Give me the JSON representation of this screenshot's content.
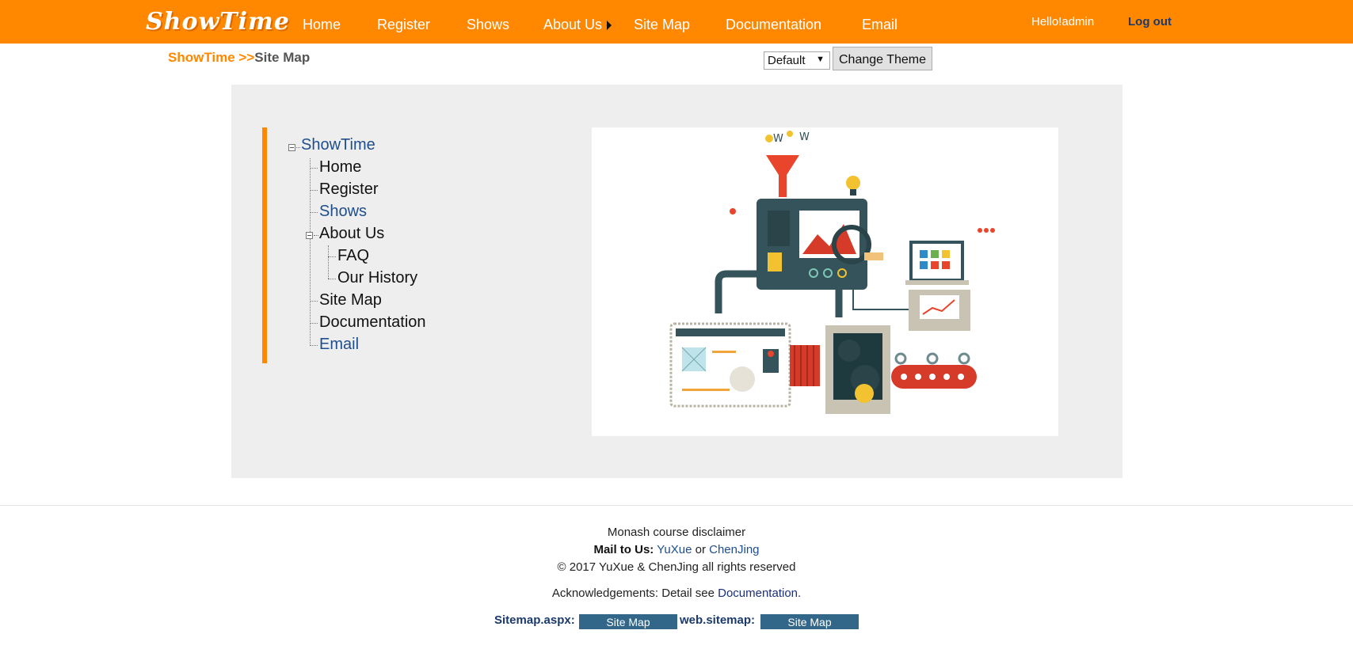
{
  "header": {
    "logo": "ShowTime",
    "nav": [
      {
        "label": "Home"
      },
      {
        "label": "Register"
      },
      {
        "label": "Shows"
      },
      {
        "label": "About Us"
      },
      {
        "label": "Site Map"
      },
      {
        "label": "Documentation"
      },
      {
        "label": "Email"
      }
    ],
    "greeting": "Hello!admin",
    "logout": "Log out"
  },
  "breadcrumb": {
    "root": "ShowTime",
    "separator": " >>",
    "current": "Site Map"
  },
  "theme": {
    "selected": "Default",
    "button": "Change Theme"
  },
  "tree": {
    "root": "ShowTime",
    "items": [
      "Home",
      "Register",
      "Shows",
      "About Us",
      "FAQ",
      "Our History",
      "Site Map",
      "Documentation",
      "Email"
    ]
  },
  "footer": {
    "disclaimer": "Monash course disclaimer",
    "mail_label": "Mail to Us:",
    "mail_name_1": "YuXue",
    "mail_or": "or",
    "mail_name_2": "ChenJing",
    "copyright": "© 2017 YuXue & ChenJing all rights reserved",
    "ack_prefix": "Acknowledgements: Detail see",
    "ack_link": "Documentation.",
    "sitemap_aspx_label": "Sitemap.aspx:",
    "sitemap_aspx_button": "Site Map",
    "web_sitemap_label": "web.sitemap:",
    "web_sitemap_button": "Site Map"
  },
  "colors": {
    "brand_orange": "#ff8800",
    "link_blue": "#1f4e8c",
    "panel_grey": "#eeeeee",
    "sitemap_button": "#33678a"
  }
}
